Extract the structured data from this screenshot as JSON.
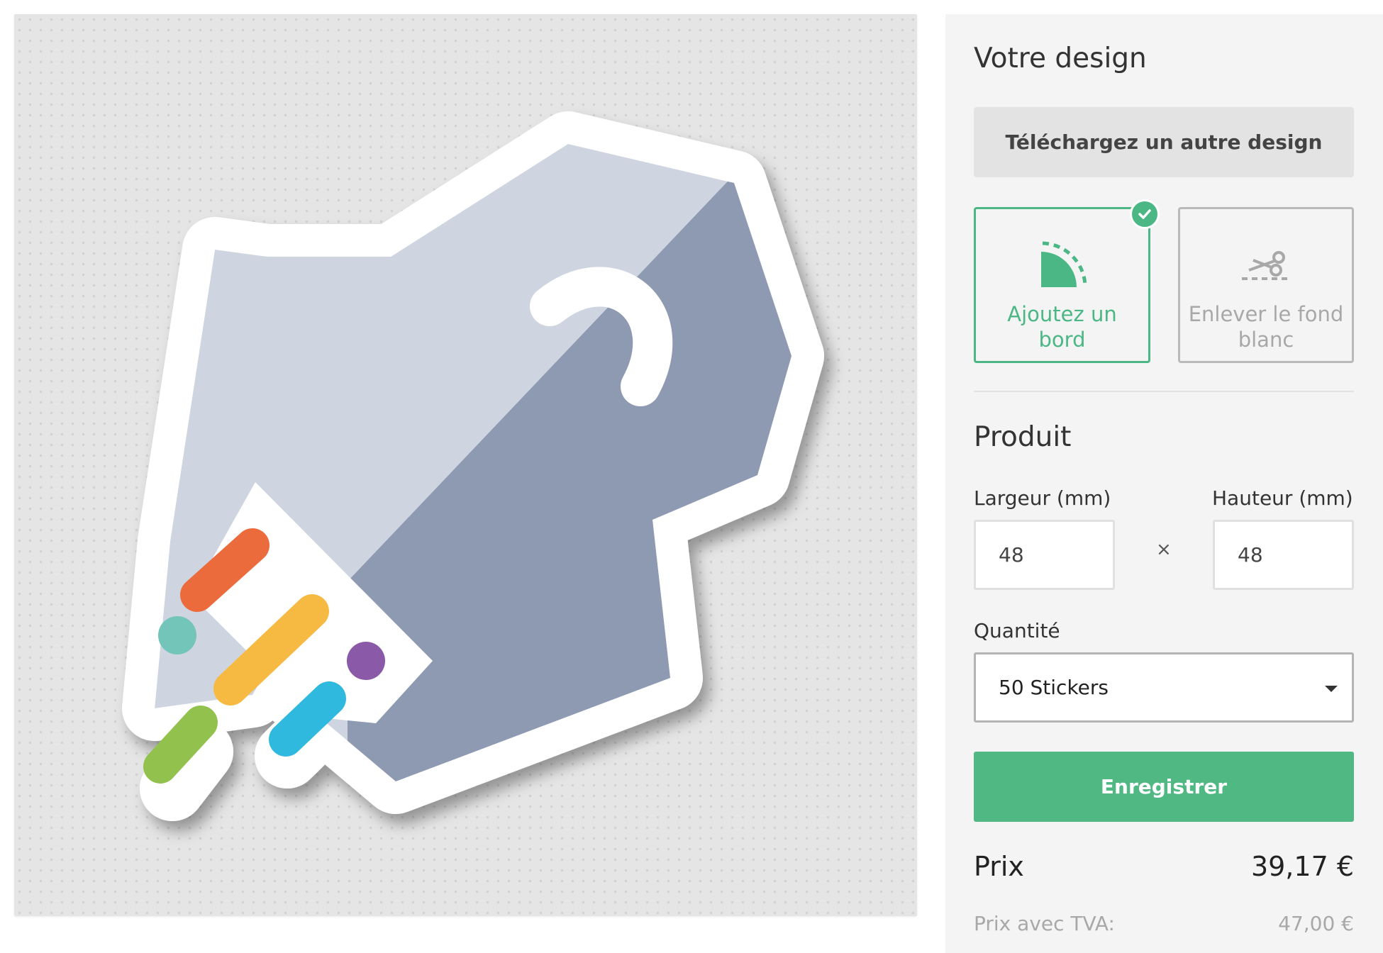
{
  "design": {
    "title": "Votre design",
    "upload_label": "Téléchargez un autre design",
    "options": [
      {
        "label": "Ajoutez un bord",
        "selected": true,
        "icon": "border-icon"
      },
      {
        "label": "Enlever le fond blanc",
        "selected": false,
        "icon": "scissors-icon"
      }
    ]
  },
  "product": {
    "title": "Produit",
    "width_label": "Largeur (mm)",
    "width_value": "48",
    "height_label": "Hauteur (mm)",
    "height_value": "48",
    "times_symbol": "×",
    "quantity_label": "Quantité",
    "quantity_value": "50 Stickers"
  },
  "actions": {
    "save_label": "Enregistrer"
  },
  "price": {
    "label": "Prix",
    "value": "39,17 €",
    "vat_label": "Prix avec TVA:",
    "vat_value": "47,00 €"
  },
  "colors": {
    "accent": "#50b882",
    "border_active": "#4bb784",
    "rocket_light": "#cfd5e0",
    "rocket_dark": "#8e9ab2",
    "stripe_orange": "#ec6b3d",
    "stripe_yellow": "#f6ba42",
    "stripe_green": "#93c14d",
    "stripe_blue": "#2fb9de",
    "dot_teal": "#72c5b8",
    "dot_purple": "#8a5aa8"
  }
}
